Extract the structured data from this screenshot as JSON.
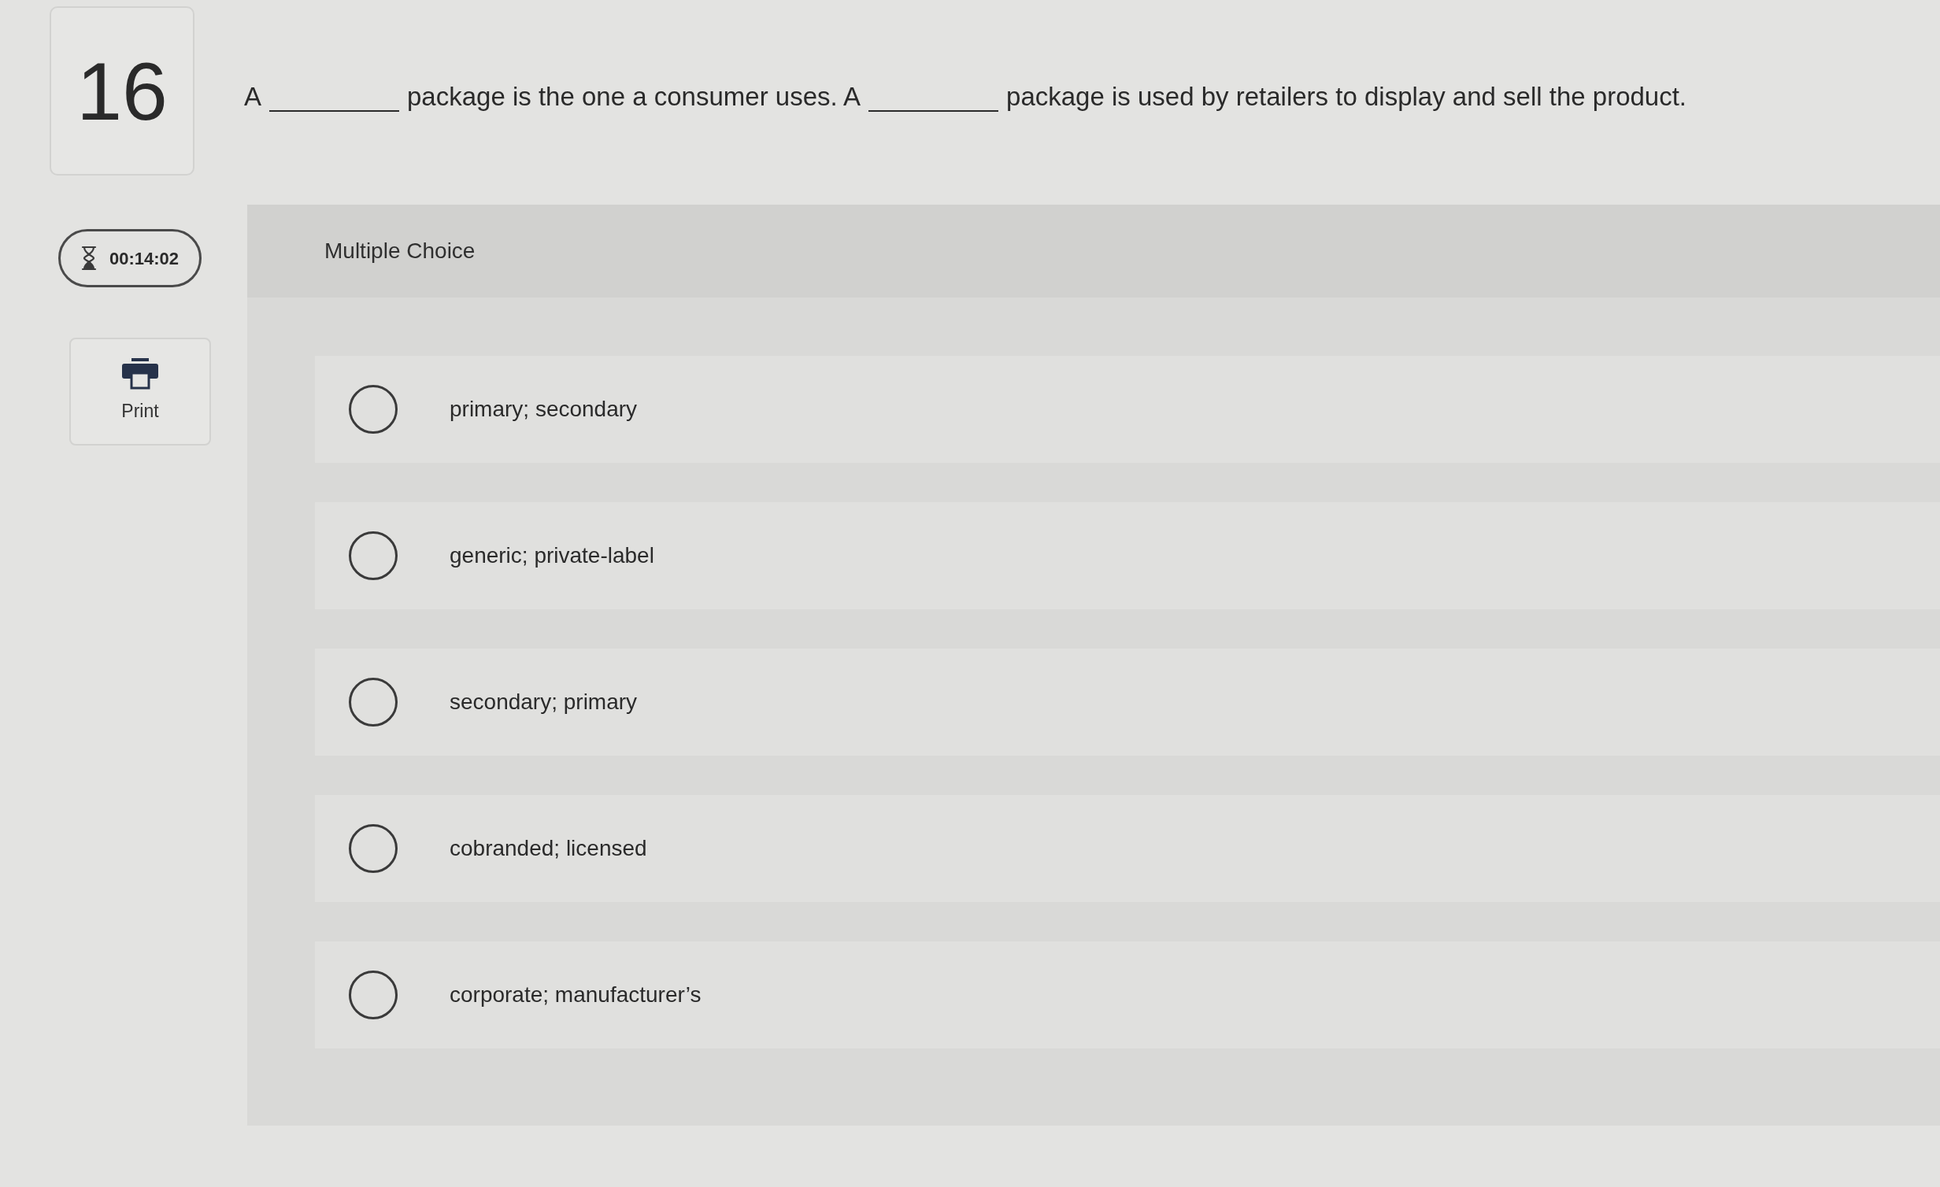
{
  "question": {
    "number": "16",
    "parts": [
      {
        "kind": "text",
        "text": "A"
      },
      {
        "kind": "blank"
      },
      {
        "kind": "text",
        "text": "package is the one a consumer uses. A"
      },
      {
        "kind": "blank"
      },
      {
        "kind": "text",
        "text": "package is used by retailers to display and sell the product."
      }
    ]
  },
  "timer": {
    "text": "00:14:02"
  },
  "print_button": {
    "label": "Print"
  },
  "question_type": "Multiple Choice",
  "options": [
    {
      "label": "primary; secondary",
      "selected": false
    },
    {
      "label": "generic; private-label",
      "selected": false
    },
    {
      "label": "secondary; primary",
      "selected": false
    },
    {
      "label": "cobranded; licensed",
      "selected": false
    },
    {
      "label": "corporate; manufacturer’s",
      "selected": false
    }
  ]
}
